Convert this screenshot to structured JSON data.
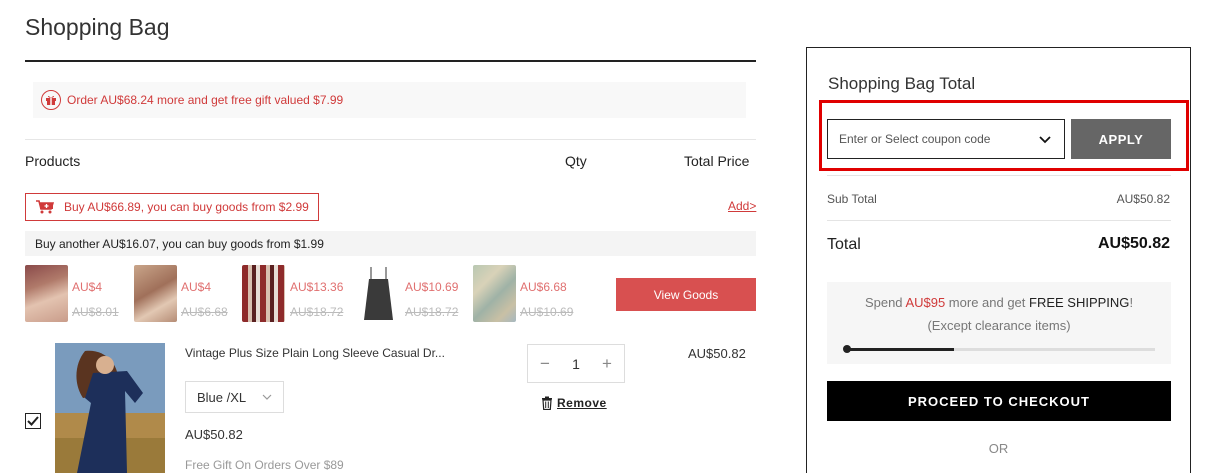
{
  "page": {
    "title": "Shopping Bag"
  },
  "gift_banner": {
    "text": "Order AU$68.24 more and get free gift valued $7.99"
  },
  "columns": {
    "products": "Products",
    "qty": "Qty",
    "total_price": "Total Price"
  },
  "addon": {
    "promo_text": "Buy AU$66.89, you can buy goods from $2.99",
    "add_link": "Add>",
    "another_text": "Buy another AU$16.07, you can buy goods from $1.99",
    "items": [
      {
        "price": "AU$4",
        "original": "AU$8.01"
      },
      {
        "price": "AU$4",
        "original": "AU$6.68"
      },
      {
        "price": "AU$13.36",
        "original": "AU$18.72"
      },
      {
        "price": "AU$10.69",
        "original": "AU$18.72"
      },
      {
        "price": "AU$6.68",
        "original": "AU$10.69"
      }
    ],
    "view_goods_label": "View Goods"
  },
  "cart_item": {
    "name": "Vintage Plus Size Plain Long Sleeve Casual Dr...",
    "variant": "Blue /XL",
    "price": "AU$50.82",
    "free_gift_text": "Free Gift On Orders Over $89",
    "qty": "1",
    "qty_minus": "−",
    "qty_plus": "+",
    "remove_label": "Remove",
    "line_total": "AU$50.82",
    "checked": true
  },
  "summary": {
    "title": "Shopping Bag Total",
    "coupon_placeholder": "Enter or Select coupon code",
    "apply_label": "APPLY",
    "subtotal_label": "Sub Total",
    "subtotal_value": "AU$50.82",
    "total_label": "Total",
    "total_value": "AU$50.82",
    "shipping": {
      "spend_prefix": "Spend ",
      "spend_amount": "AU$95",
      "spend_middle": " more and get ",
      "free_shipping": "FREE SHIPPING",
      "spend_suffix": "!",
      "note": "(Except clearance items)",
      "progress_fraction": 0.35
    },
    "checkout_label": "PROCEED TO CHECKOUT",
    "or_text": "OR"
  },
  "colors": {
    "accent_red": "#d03a3a",
    "highlight_frame": "#e00000",
    "apply_button": "#666666",
    "checkout_button": "#000000"
  }
}
